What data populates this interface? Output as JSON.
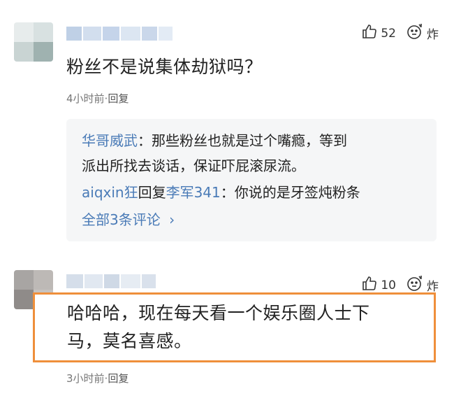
{
  "comment1": {
    "likes": "52",
    "explode_label": "炸",
    "text": "粉丝不是说集体劫狱吗？",
    "time": "4小时前",
    "separator": "·",
    "reply_label": "回复",
    "replies": [
      {
        "user": "华哥威武",
        "colon": "：",
        "text_line1": "那些粉丝也就是过个嘴瘾，等到",
        "text_line2": "派出所找去谈话，保证吓屁滚尿流。"
      },
      {
        "user": "aiqxin狂",
        "reply_word": "回复",
        "target": "李军341",
        "colon": "：",
        "text": "你说的是牙签炖粉条"
      }
    ],
    "all_replies": "全部3条评论",
    "all_replies_chevron": "›"
  },
  "comment2": {
    "likes": "10",
    "explode_label": "炸",
    "text_line1": "哈哈哈，现在每天看一个娱乐圈人士下",
    "text_line2": "马，莫名喜感。",
    "time": "3小时前",
    "separator": "·",
    "reply_label": "回复"
  },
  "icons": [
    "thumbs-up-icon",
    "explode-icon"
  ],
  "colors": {
    "link_blue": "#4a7bb7",
    "highlight_border": "#ef8f3b"
  }
}
